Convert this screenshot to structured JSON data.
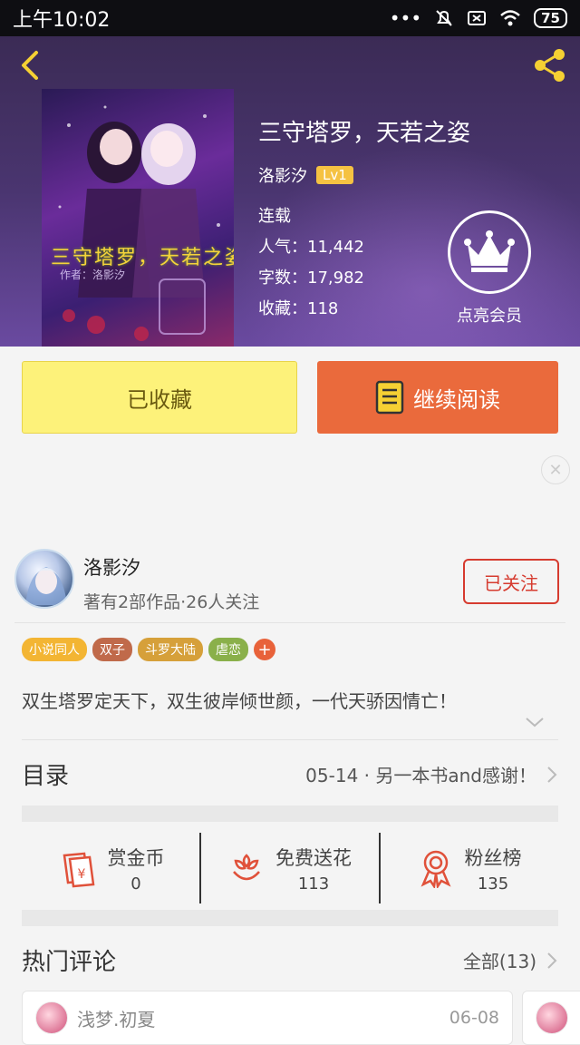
{
  "status": {
    "time": "上午10:02",
    "battery": "75"
  },
  "book": {
    "title": "三守塔罗，天若之姿",
    "author": "洛影汐",
    "level": "Lv1",
    "state": "连载",
    "popularity": "人气：11,442",
    "words": "字数：17,982",
    "favorites": "收藏：118",
    "cover_title": "三守塔罗，天若之姿",
    "cover_author": "作者：洛影汐"
  },
  "vip": {
    "label": "点亮会员"
  },
  "actions": {
    "collected": "已收藏",
    "continue": "继续阅读"
  },
  "author_card": {
    "name": "洛影汐",
    "meta": "著有2部作品·26人关注",
    "follow": "已关注"
  },
  "tags": [
    {
      "label": "小说同人",
      "color": "#f3b533"
    },
    {
      "label": "双子",
      "color": "#c06a4a"
    },
    {
      "label": "斗罗大陆",
      "color": "#d6a03a"
    },
    {
      "label": "虐恋",
      "color": "#8ab04a"
    }
  ],
  "summary": "双生塔罗定天下，双生彼岸倾世颜，一代天骄因情亡！",
  "toc": {
    "label": "目录",
    "latest": "05-14 · 另一本书and感谢！"
  },
  "stats": [
    {
      "name": "赏金币",
      "value": "0",
      "icon": "reward-coin-icon"
    },
    {
      "name": "免费送花",
      "value": "113",
      "icon": "flower-icon"
    },
    {
      "name": "粉丝榜",
      "value": "135",
      "icon": "medal-icon"
    }
  ],
  "comments": {
    "title": "热门评论",
    "all": "全部(13)",
    "items": [
      {
        "user": "浅梦.初夏",
        "date": "06-08"
      }
    ]
  },
  "colors": {
    "accent": "#ea6a3c",
    "follow": "#d63b2f",
    "collect": "#fdf27a",
    "icon": "#e0513a"
  }
}
